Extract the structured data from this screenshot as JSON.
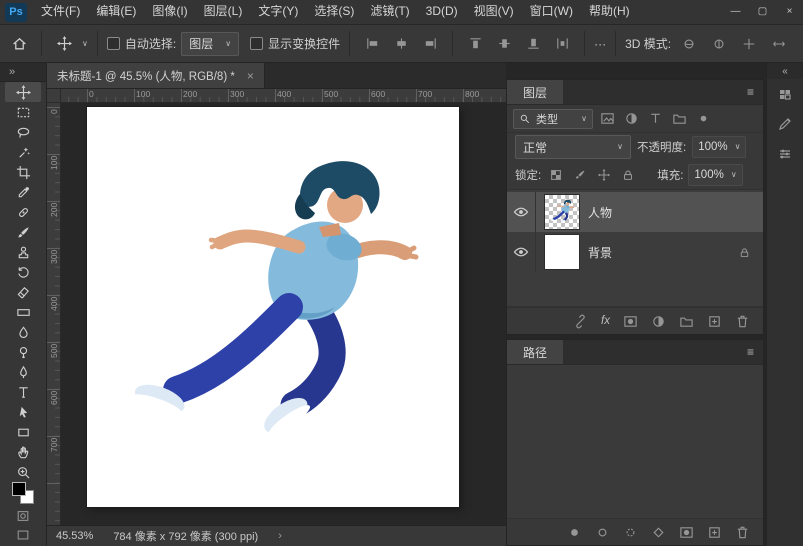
{
  "app": {
    "logo_text": "Ps"
  },
  "window_controls": {
    "minimize": "—",
    "maximize": "▢",
    "close": "×"
  },
  "menu": {
    "items": [
      "文件(F)",
      "编辑(E)",
      "图像(I)",
      "图层(L)",
      "文字(Y)",
      "选择(S)",
      "滤镜(T)",
      "3D(D)",
      "视图(V)",
      "窗口(W)",
      "帮助(H)"
    ]
  },
  "options_bar": {
    "auto_select_label": "自动选择:",
    "auto_select_value": "图层",
    "show_transform_label": "显示变换控件",
    "more_button": "···",
    "mode_3d_label": "3D 模式:",
    "caret": "∨"
  },
  "document": {
    "tab_title": "未标题-1 @ 45.5% (人物, RGB/8) *",
    "tab_close": "×"
  },
  "toolbar": {
    "chevron": "»",
    "tools": [
      "move",
      "marquee",
      "lasso",
      "object-selection",
      "crop",
      "eyedropper",
      "healing",
      "brush",
      "clone-stamp",
      "history-brush",
      "eraser",
      "gradient",
      "blur",
      "dodge",
      "pen",
      "type",
      "path-select",
      "shape",
      "hand",
      "zoom"
    ],
    "active_tool": "move"
  },
  "rulers": {
    "top": [
      "0",
      "100",
      "200",
      "300",
      "400",
      "500",
      "600",
      "700",
      "800"
    ],
    "left": [
      "0",
      "100",
      "200",
      "300",
      "400",
      "500",
      "600",
      "700"
    ]
  },
  "layers_panel": {
    "tab": "图层",
    "panel_menu": "≡",
    "filter_label": "类型",
    "blend_mode": "正常",
    "opacity_label": "不透明度:",
    "opacity_value": "100%",
    "lock_label": "锁定:",
    "fill_label": "填充:",
    "fill_value": "100%",
    "layers": [
      {
        "name": "人物",
        "visible": true,
        "selected": true,
        "thumbnail": "character-on-transparency"
      },
      {
        "name": "背景",
        "visible": true,
        "locked": true,
        "thumbnail": "white"
      }
    ],
    "fx_label": "fx"
  },
  "paths_panel": {
    "tab": "路径",
    "panel_menu": "≡"
  },
  "dock_strip": {
    "expand_chevron": "«"
  },
  "status_bar": {
    "zoom": "45.53%",
    "doc_size": "784 像素 x 792 像素 (300 ppi)",
    "chevron": "›"
  },
  "colors": {
    "ui_background": "#383838",
    "canvas_surround": "#272727",
    "selected_layer": "#525252",
    "accent_blue": "#45a8f5",
    "character_shirt": "#84bbdc",
    "character_pants": "#2e41a8",
    "character_hair": "#1d4b66",
    "character_skin": "#e2a883",
    "character_shoes": "#dde9f4",
    "canvas": "#ffffff"
  },
  "icons": {
    "home-icon": "house shape",
    "move-tool-icon": "cross arrows",
    "marquee-tool-icon": "dashed rectangle",
    "search-icon": "magnifier",
    "eye-icon": "visibility eye",
    "lock-icon": "padlock",
    "link-icon": "chain",
    "mask-icon": "rect with circle",
    "adjustment-icon": "half-filled circle",
    "folder-icon": "folder",
    "new-layer-icon": "square with plus",
    "trash-icon": "trash can"
  }
}
